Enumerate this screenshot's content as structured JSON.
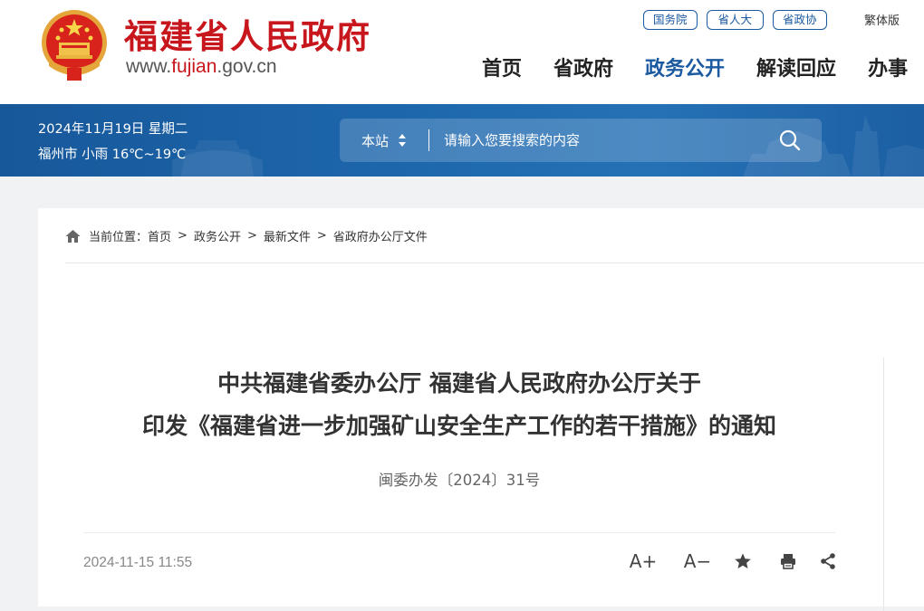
{
  "header": {
    "site_title": "福建省人民政府",
    "site_url_prefix": "www.",
    "site_url_accent": "fujian",
    "site_url_suffix": ".gov.cn",
    "top_links": [
      "国务院",
      "省人大",
      "省政协"
    ],
    "lang_switch": "繁体版",
    "nav": [
      "首页",
      "省政府",
      "政务公开",
      "解读回应",
      "办事"
    ],
    "active_nav": "政务公开"
  },
  "banner": {
    "date": "2024年11月19日 星期二",
    "weather": "福州市 小雨 16℃~19℃",
    "search_scope": "本站",
    "search_placeholder": "请输入您要搜索的内容"
  },
  "breadcrumb": {
    "label": "当前位置：",
    "items": [
      "首页",
      "政务公开",
      "最新文件",
      "省政府办公厅文件"
    ],
    "separator": ">"
  },
  "article": {
    "title_line1": "中共福建省委办公厅 福建省人民政府办公厅关于",
    "title_line2": "印发《福建省进一步加强矿山安全生产工作的若干措施》的通知",
    "doc_number": "闽委办发〔2024〕31号",
    "publish_time": "2024-11-15 11:55",
    "tools": {
      "font_up": "A+",
      "font_down": "A−",
      "icons": [
        "font-increase-icon",
        "font-decrease-icon",
        "star-icon",
        "print-icon",
        "share-icon"
      ]
    }
  },
  "colors": {
    "brand_red": "#c8161d",
    "brand_blue": "#1b5aa0",
    "banner_blue": "#1e67ad",
    "page_bg": "#f1f2f4"
  }
}
